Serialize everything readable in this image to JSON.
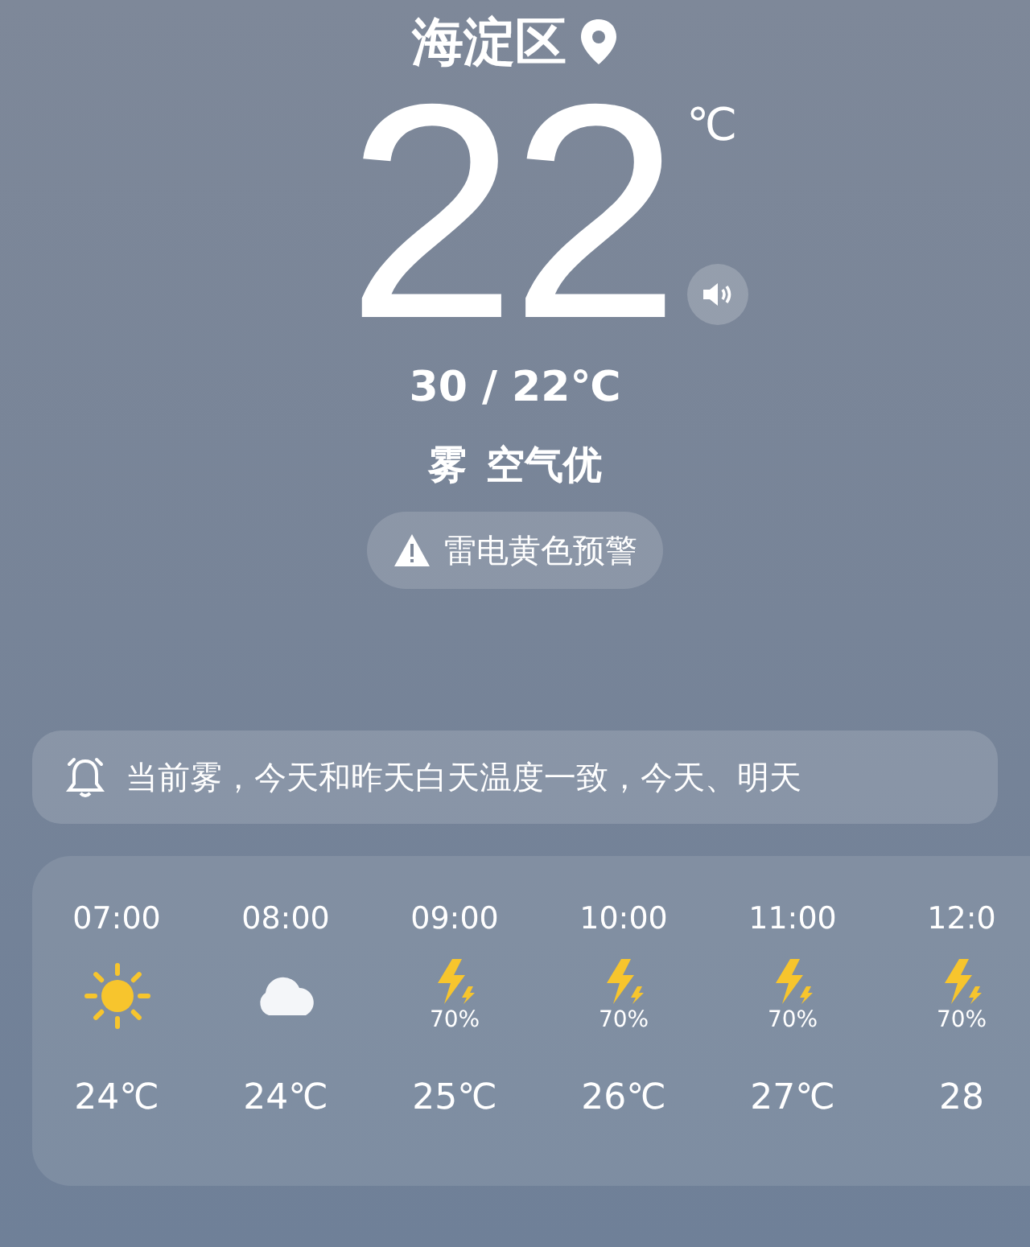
{
  "location": {
    "name": "海淀区"
  },
  "current": {
    "temperature": "22",
    "unit": "℃",
    "range": "30 / 22℃",
    "condition": "雾",
    "air_quality": "空气优"
  },
  "alert": {
    "text": "雷电黄色预警"
  },
  "notice": {
    "text": "当前雾，今天和昨天白天温度一致，今天、明天"
  },
  "hourly": [
    {
      "time": "07:00",
      "kind": "sun",
      "temp": "24℃"
    },
    {
      "time": "08:00",
      "kind": "cloud",
      "temp": "24℃"
    },
    {
      "time": "09:00",
      "kind": "thunder",
      "precip": "70%",
      "temp": "25℃"
    },
    {
      "time": "10:00",
      "kind": "thunder",
      "precip": "70%",
      "temp": "26℃"
    },
    {
      "time": "11:00",
      "kind": "thunder",
      "precip": "70%",
      "temp": "27℃"
    },
    {
      "time": "12:0",
      "kind": "thunder",
      "precip": "70%",
      "temp": "28"
    }
  ]
}
